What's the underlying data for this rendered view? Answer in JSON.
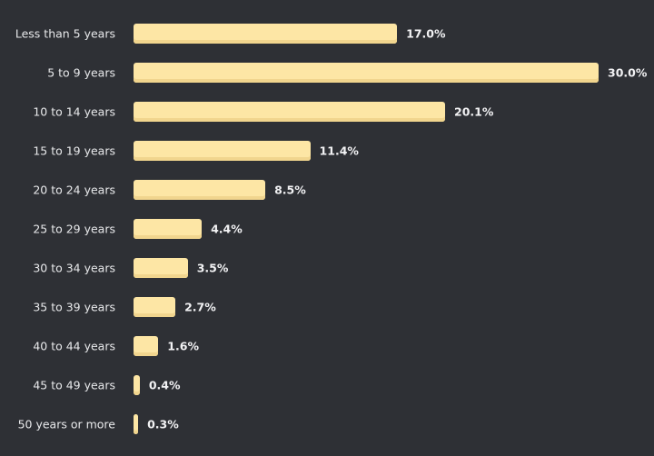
{
  "chart_data": {
    "type": "bar",
    "orientation": "horizontal",
    "title": "",
    "xlabel": "",
    "ylabel": "",
    "xlim": [
      0,
      30
    ],
    "grid": false,
    "categories": [
      "Less than 5 years",
      "5 to 9 years",
      "10 to 14 years",
      "15 to 19 years",
      "20 to 24 years",
      "25 to 29 years",
      "30 to 34 years",
      "35 to 39 years",
      "40 to 44 years",
      "45 to 49 years",
      "50 years or more"
    ],
    "values": [
      17.0,
      30.0,
      20.1,
      11.4,
      8.5,
      4.4,
      3.5,
      2.7,
      1.6,
      0.4,
      0.3
    ],
    "value_labels": [
      "17.0%",
      "30.0%",
      "20.1%",
      "11.4%",
      "8.5%",
      "4.4%",
      "3.5%",
      "2.7%",
      "1.6%",
      "0.4%",
      "0.3%"
    ],
    "unit": "%",
    "colors": {
      "bar": "#fde6a5",
      "background": "#2e3035",
      "text": "#e8e9eb"
    }
  }
}
